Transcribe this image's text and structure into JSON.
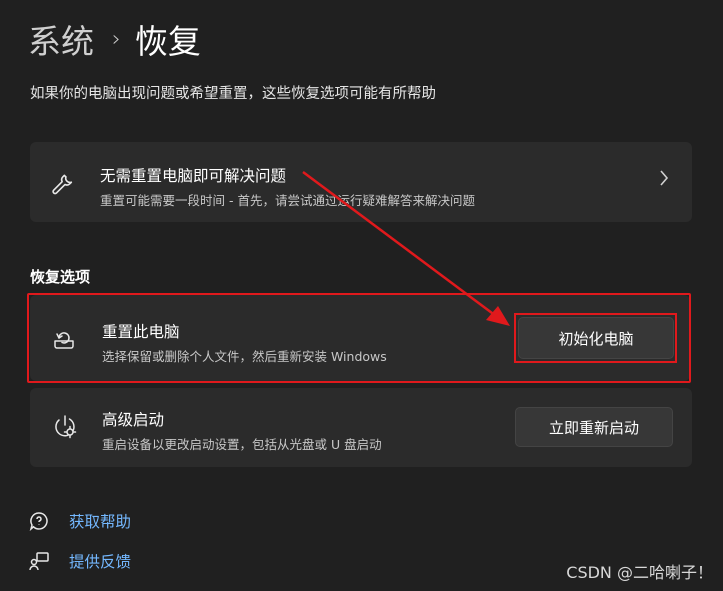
{
  "breadcrumb": {
    "parent": "系统",
    "separator": "›",
    "current": "恢复"
  },
  "intro_text": "如果你的电脑出现问题或希望重置，这些恢复选项可能有所帮助",
  "troubleshoot_card": {
    "title": "无需重置电脑即可解决问题",
    "description": "重置可能需要一段时间 - 首先，请尝试通过运行疑难解答来解决问题",
    "icon": "wrench-icon"
  },
  "recovery_options": {
    "heading": "恢复选项",
    "reset": {
      "title": "重置此电脑",
      "description": "选择保留或删除个人文件，然后重新安装 Windows",
      "button": "初始化电脑",
      "icon": "reset-pc-icon"
    },
    "advanced": {
      "title": "高级启动",
      "description": "重启设备以更改启动设置，包括从光盘或 U 盘启动",
      "button": "立即重新启动",
      "icon": "power-gear-icon"
    }
  },
  "links": {
    "help": "获取帮助",
    "feedback": "提供反馈"
  },
  "watermark": "CSDN @二哈喇子！",
  "colors": {
    "background": "#202020",
    "card": "#2b2b2b",
    "link": "#74b8ff",
    "annotation": "#e0191c"
  }
}
